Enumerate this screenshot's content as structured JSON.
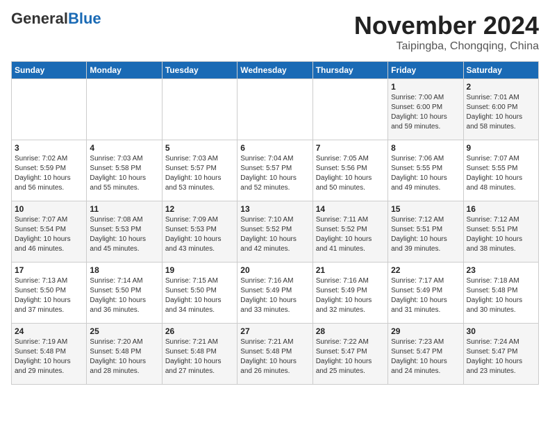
{
  "logo": {
    "text_general": "General",
    "text_blue": "Blue"
  },
  "header": {
    "month": "November 2024",
    "location": "Taipingba, Chongqing, China"
  },
  "weekdays": [
    "Sunday",
    "Monday",
    "Tuesday",
    "Wednesday",
    "Thursday",
    "Friday",
    "Saturday"
  ],
  "weeks": [
    [
      {
        "day": "",
        "info": ""
      },
      {
        "day": "",
        "info": ""
      },
      {
        "day": "",
        "info": ""
      },
      {
        "day": "",
        "info": ""
      },
      {
        "day": "",
        "info": ""
      },
      {
        "day": "1",
        "info": "Sunrise: 7:00 AM\nSunset: 6:00 PM\nDaylight: 10 hours\nand 59 minutes."
      },
      {
        "day": "2",
        "info": "Sunrise: 7:01 AM\nSunset: 6:00 PM\nDaylight: 10 hours\nand 58 minutes."
      }
    ],
    [
      {
        "day": "3",
        "info": "Sunrise: 7:02 AM\nSunset: 5:59 PM\nDaylight: 10 hours\nand 56 minutes."
      },
      {
        "day": "4",
        "info": "Sunrise: 7:03 AM\nSunset: 5:58 PM\nDaylight: 10 hours\nand 55 minutes."
      },
      {
        "day": "5",
        "info": "Sunrise: 7:03 AM\nSunset: 5:57 PM\nDaylight: 10 hours\nand 53 minutes."
      },
      {
        "day": "6",
        "info": "Sunrise: 7:04 AM\nSunset: 5:57 PM\nDaylight: 10 hours\nand 52 minutes."
      },
      {
        "day": "7",
        "info": "Sunrise: 7:05 AM\nSunset: 5:56 PM\nDaylight: 10 hours\nand 50 minutes."
      },
      {
        "day": "8",
        "info": "Sunrise: 7:06 AM\nSunset: 5:55 PM\nDaylight: 10 hours\nand 49 minutes."
      },
      {
        "day": "9",
        "info": "Sunrise: 7:07 AM\nSunset: 5:55 PM\nDaylight: 10 hours\nand 48 minutes."
      }
    ],
    [
      {
        "day": "10",
        "info": "Sunrise: 7:07 AM\nSunset: 5:54 PM\nDaylight: 10 hours\nand 46 minutes."
      },
      {
        "day": "11",
        "info": "Sunrise: 7:08 AM\nSunset: 5:53 PM\nDaylight: 10 hours\nand 45 minutes."
      },
      {
        "day": "12",
        "info": "Sunrise: 7:09 AM\nSunset: 5:53 PM\nDaylight: 10 hours\nand 43 minutes."
      },
      {
        "day": "13",
        "info": "Sunrise: 7:10 AM\nSunset: 5:52 PM\nDaylight: 10 hours\nand 42 minutes."
      },
      {
        "day": "14",
        "info": "Sunrise: 7:11 AM\nSunset: 5:52 PM\nDaylight: 10 hours\nand 41 minutes."
      },
      {
        "day": "15",
        "info": "Sunrise: 7:12 AM\nSunset: 5:51 PM\nDaylight: 10 hours\nand 39 minutes."
      },
      {
        "day": "16",
        "info": "Sunrise: 7:12 AM\nSunset: 5:51 PM\nDaylight: 10 hours\nand 38 minutes."
      }
    ],
    [
      {
        "day": "17",
        "info": "Sunrise: 7:13 AM\nSunset: 5:50 PM\nDaylight: 10 hours\nand 37 minutes."
      },
      {
        "day": "18",
        "info": "Sunrise: 7:14 AM\nSunset: 5:50 PM\nDaylight: 10 hours\nand 36 minutes."
      },
      {
        "day": "19",
        "info": "Sunrise: 7:15 AM\nSunset: 5:50 PM\nDaylight: 10 hours\nand 34 minutes."
      },
      {
        "day": "20",
        "info": "Sunrise: 7:16 AM\nSunset: 5:49 PM\nDaylight: 10 hours\nand 33 minutes."
      },
      {
        "day": "21",
        "info": "Sunrise: 7:16 AM\nSunset: 5:49 PM\nDaylight: 10 hours\nand 32 minutes."
      },
      {
        "day": "22",
        "info": "Sunrise: 7:17 AM\nSunset: 5:49 PM\nDaylight: 10 hours\nand 31 minutes."
      },
      {
        "day": "23",
        "info": "Sunrise: 7:18 AM\nSunset: 5:48 PM\nDaylight: 10 hours\nand 30 minutes."
      }
    ],
    [
      {
        "day": "24",
        "info": "Sunrise: 7:19 AM\nSunset: 5:48 PM\nDaylight: 10 hours\nand 29 minutes."
      },
      {
        "day": "25",
        "info": "Sunrise: 7:20 AM\nSunset: 5:48 PM\nDaylight: 10 hours\nand 28 minutes."
      },
      {
        "day": "26",
        "info": "Sunrise: 7:21 AM\nSunset: 5:48 PM\nDaylight: 10 hours\nand 27 minutes."
      },
      {
        "day": "27",
        "info": "Sunrise: 7:21 AM\nSunset: 5:48 PM\nDaylight: 10 hours\nand 26 minutes."
      },
      {
        "day": "28",
        "info": "Sunrise: 7:22 AM\nSunset: 5:47 PM\nDaylight: 10 hours\nand 25 minutes."
      },
      {
        "day": "29",
        "info": "Sunrise: 7:23 AM\nSunset: 5:47 PM\nDaylight: 10 hours\nand 24 minutes."
      },
      {
        "day": "30",
        "info": "Sunrise: 7:24 AM\nSunset: 5:47 PM\nDaylight: 10 hours\nand 23 minutes."
      }
    ]
  ]
}
